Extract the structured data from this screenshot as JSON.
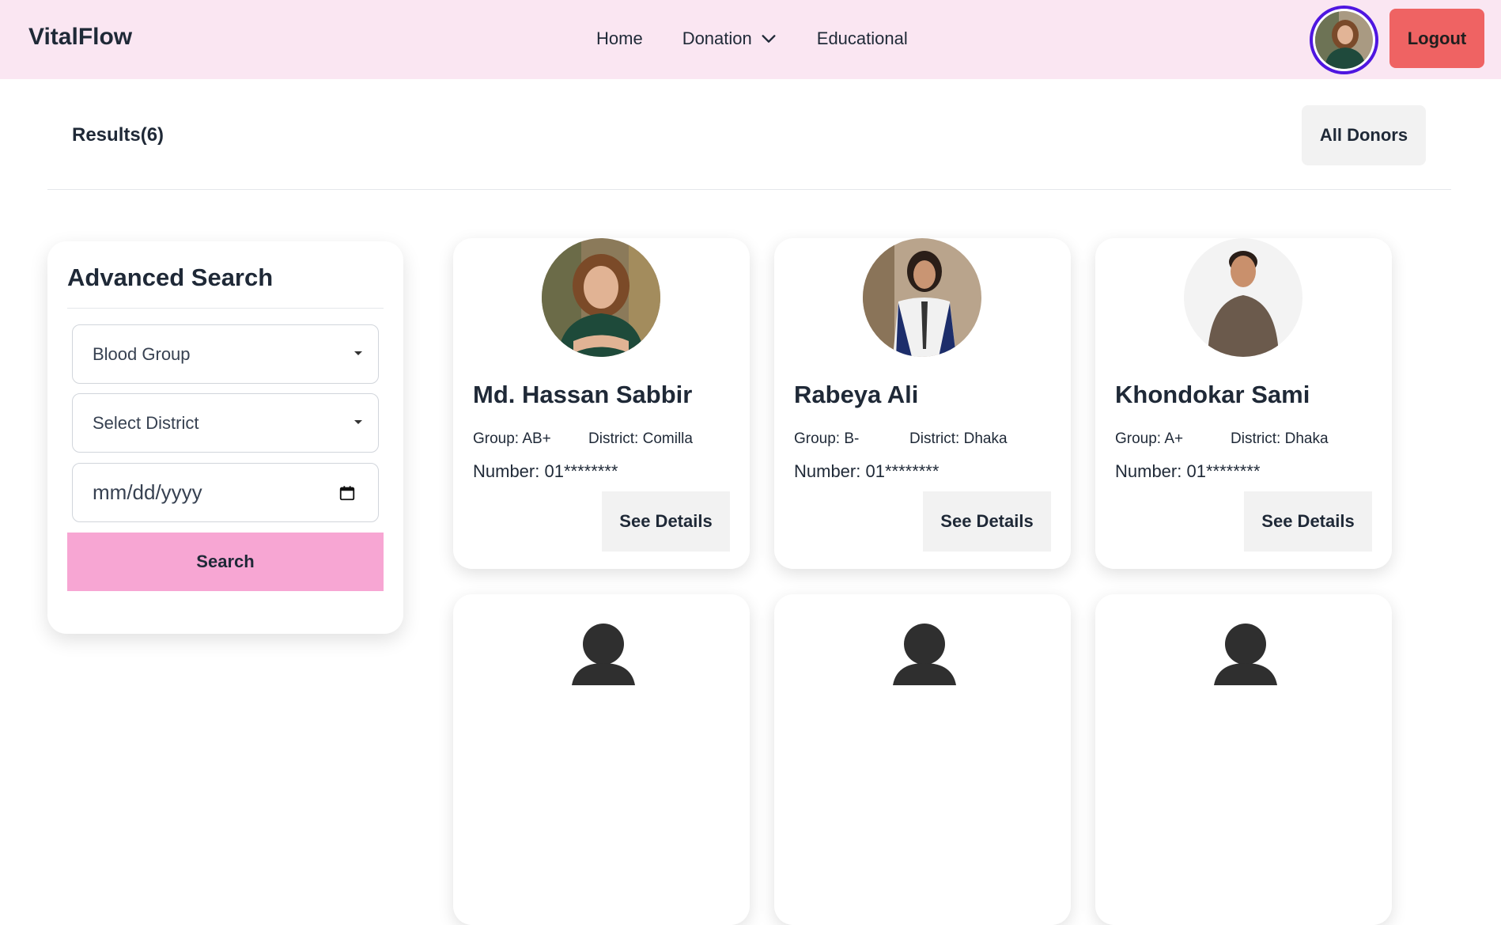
{
  "navbar": {
    "brand": "VitalFlow",
    "links": [
      {
        "label": "Home"
      },
      {
        "label": "Donation",
        "icon": "chevron-down-icon"
      },
      {
        "label": "Educational"
      }
    ],
    "avatar_icon": "user-avatar",
    "logout_label": "Logout",
    "colors": {
      "background": "#fae6f2",
      "logout": "#ef6363",
      "avatar_ring": "#4f16e0"
    }
  },
  "results": {
    "title": "Results(6)",
    "all_donors_label": "All Donors"
  },
  "search": {
    "title": "Advanced Search",
    "blood_group_placeholder": "Blood Group",
    "district_placeholder": "Select District",
    "date_placeholder": "mm/dd/yyyy",
    "button_label": "Search",
    "button_color": "#f7a6d3"
  },
  "donors": [
    {
      "name": "Md. Hassan Sabbir",
      "group": "Group: AB+",
      "district": "District: Comilla",
      "number": "Number: 01********",
      "button": "See Details"
    },
    {
      "name": "Rabeya Ali",
      "group": "Group: B-",
      "district": "District: Dhaka",
      "number": "Number: 01********",
      "button": "See Details"
    },
    {
      "name": "Khondokar Sami",
      "group": "Group: A+",
      "district": "District: Dhaka",
      "number": "Number: 01********",
      "button": "See Details"
    }
  ]
}
